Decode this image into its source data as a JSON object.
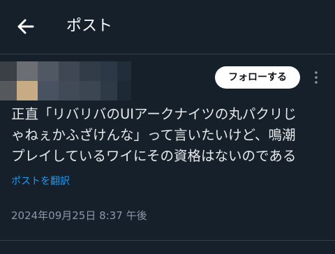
{
  "header": {
    "title": "ポスト"
  },
  "author": {
    "follow_label": "フォローする"
  },
  "post": {
    "lines": [
      "正直「リバリバのUIアークナイツの丸パクリじ",
      "ゃねぇかふざけんな」って言いたいけど、鳴潮",
      "プレイしているワイにその資格はないのである"
    ],
    "translate_label": "ポストを翻訳",
    "timestamp": "2024年09月25日 8:37 午後"
  },
  "colors": {
    "background": "#15202b",
    "link": "#1d9bf0",
    "text": "#e7e9ea",
    "muted": "#8b98a5"
  }
}
